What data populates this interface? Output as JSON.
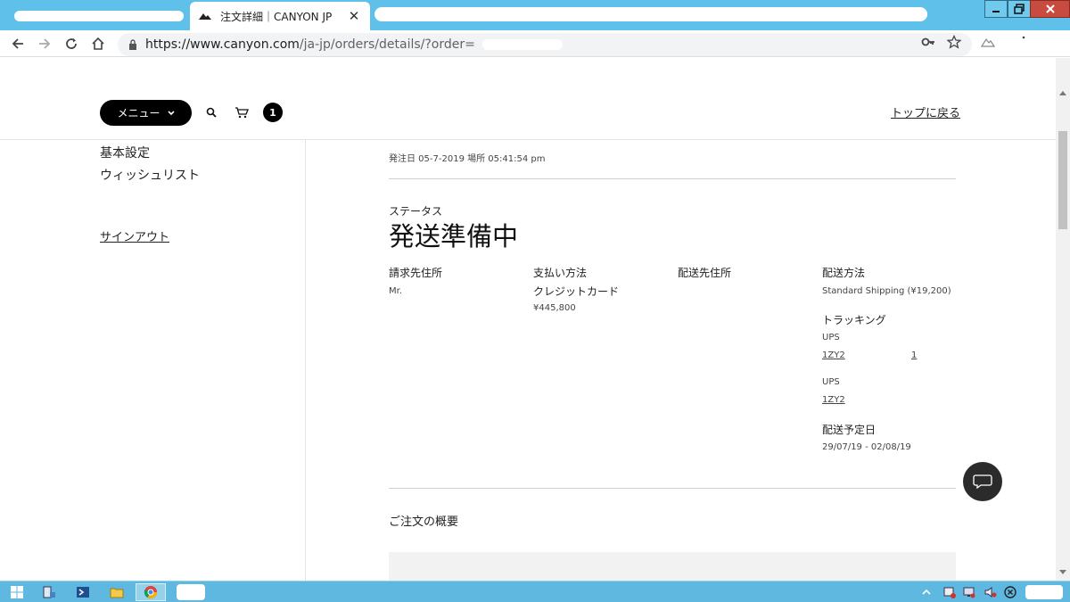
{
  "browser": {
    "tab_title": "注文詳細｜CANYON JP",
    "tab_close": "✕",
    "url_host": "https://www.canyon.com",
    "url_path": "/ja-jp/orders/details/?order="
  },
  "header": {
    "menu_label": "メニュー",
    "cart_count": "1",
    "back_to_top": "トップに戻る"
  },
  "sidebar": {
    "items": [
      "基本設定",
      "ウィッシュリスト"
    ],
    "signout": "サインアウト"
  },
  "order": {
    "date_line": "発注日 05-7-2019 場所 05:41:54 pm",
    "status_label": "ステータス",
    "status_value": "発送準備中",
    "billing_label": "請求先住所",
    "billing_value": "Mr.",
    "payment_label": "支払い方法",
    "payment_method": "クレジットカード",
    "payment_amount": "¥445,800",
    "shipping_addr_label": "配送先住所",
    "shipping_method_label": "配送方法",
    "shipping_method_value": "Standard Shipping (¥19,200)",
    "tracking_label": "トラッキング",
    "tracking": [
      {
        "carrier": "UPS",
        "number": "1ZY2",
        "extra": "1"
      },
      {
        "carrier": "UPS",
        "number": "1ZY2",
        "extra": ""
      }
    ],
    "delivery_label": "配送予定日",
    "delivery_value": "29/07/19 - 02/08/19",
    "summary_title": "ご注文の概要"
  },
  "colors": {
    "tabstrip": "#5fc1ea",
    "taskbar": "#5fb8df",
    "button_dark": "#000000"
  }
}
